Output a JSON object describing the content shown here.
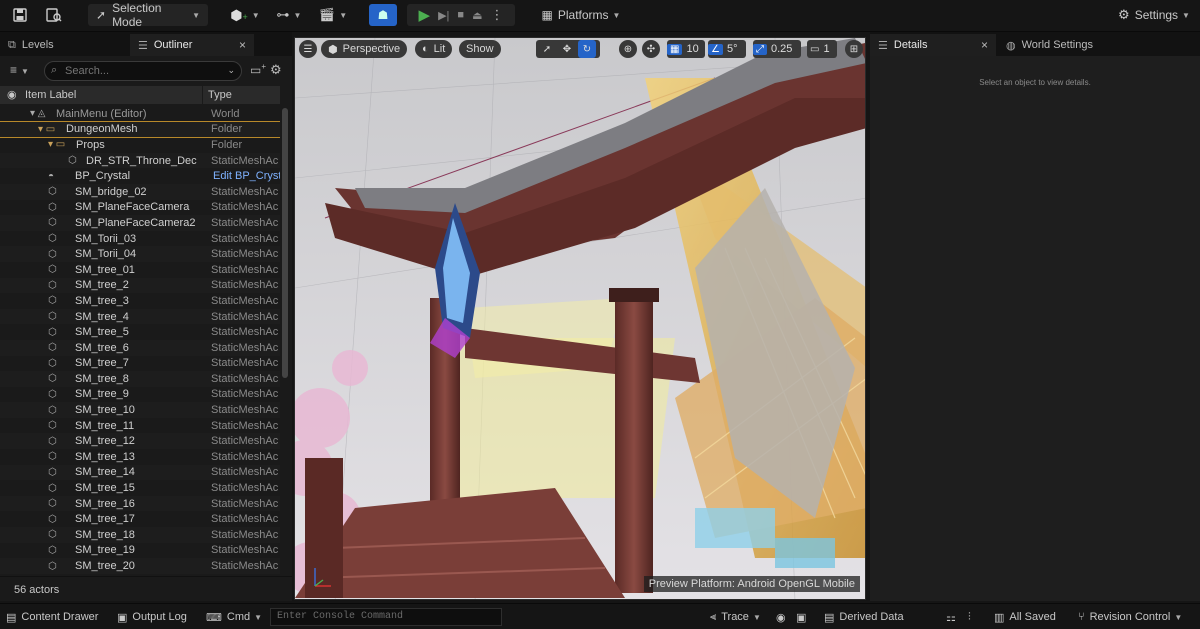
{
  "toolbar": {
    "selection_mode": "Selection Mode",
    "platforms": "Platforms",
    "settings": "Settings"
  },
  "left_panel": {
    "tabs": [
      {
        "label": "Levels"
      },
      {
        "label": "Outliner"
      }
    ],
    "close_glyph": "×",
    "search_placeholder": "Search...",
    "columns": {
      "label": "Item Label",
      "type": "Type"
    },
    "rows": [
      {
        "label": "MainMenu (Editor)",
        "type": "World",
        "indent": 0,
        "icon": "world-icon",
        "glyph": "▾ ◬"
      },
      {
        "label": "DungeonMesh",
        "type": "Folder",
        "indent": 1,
        "icon": "folder-open-icon",
        "glyph": "▾ ▭",
        "selected": true
      },
      {
        "label": "Props",
        "type": "Folder",
        "indent": 2,
        "icon": "folder-open-icon",
        "glyph": "▾ ▭"
      },
      {
        "label": "DR_STR_Throne_Dec",
        "type": "StaticMeshAc",
        "indent": 3,
        "icon": "static-mesh-icon",
        "glyph": "⬡"
      },
      {
        "label": "BP_Crystal",
        "type": "Edit BP_Cryst",
        "indent": 2,
        "icon": "blueprint-icon",
        "glyph": "◓",
        "link": true
      },
      {
        "label": "SM_bridge_02",
        "type": "StaticMeshAc",
        "indent": 2,
        "icon": "static-mesh-icon",
        "glyph": "⬡"
      },
      {
        "label": "SM_PlaneFaceCamera",
        "type": "StaticMeshAc",
        "indent": 2,
        "icon": "static-mesh-icon",
        "glyph": "⬡"
      },
      {
        "label": "SM_PlaneFaceCamera2",
        "type": "StaticMeshAc",
        "indent": 2,
        "icon": "static-mesh-icon",
        "glyph": "⬡"
      },
      {
        "label": "SM_Torii_03",
        "type": "StaticMeshAc",
        "indent": 2,
        "icon": "static-mesh-icon",
        "glyph": "⬡"
      },
      {
        "label": "SM_Torii_04",
        "type": "StaticMeshAc",
        "indent": 2,
        "icon": "static-mesh-icon",
        "glyph": "⬡"
      },
      {
        "label": "SM_tree_01",
        "type": "StaticMeshAc",
        "indent": 2,
        "icon": "static-mesh-icon",
        "glyph": "⬡"
      },
      {
        "label": "SM_tree_2",
        "type": "StaticMeshAc",
        "indent": 2,
        "icon": "static-mesh-icon",
        "glyph": "⬡"
      },
      {
        "label": "SM_tree_3",
        "type": "StaticMeshAc",
        "indent": 2,
        "icon": "static-mesh-icon",
        "glyph": "⬡"
      },
      {
        "label": "SM_tree_4",
        "type": "StaticMeshAc",
        "indent": 2,
        "icon": "static-mesh-icon",
        "glyph": "⬡"
      },
      {
        "label": "SM_tree_5",
        "type": "StaticMeshAc",
        "indent": 2,
        "icon": "static-mesh-icon",
        "glyph": "⬡"
      },
      {
        "label": "SM_tree_6",
        "type": "StaticMeshAc",
        "indent": 2,
        "icon": "static-mesh-icon",
        "glyph": "⬡"
      },
      {
        "label": "SM_tree_7",
        "type": "StaticMeshAc",
        "indent": 2,
        "icon": "static-mesh-icon",
        "glyph": "⬡"
      },
      {
        "label": "SM_tree_8",
        "type": "StaticMeshAc",
        "indent": 2,
        "icon": "static-mesh-icon",
        "glyph": "⬡"
      },
      {
        "label": "SM_tree_9",
        "type": "StaticMeshAc",
        "indent": 2,
        "icon": "static-mesh-icon",
        "glyph": "⬡"
      },
      {
        "label": "SM_tree_10",
        "type": "StaticMeshAc",
        "indent": 2,
        "icon": "static-mesh-icon",
        "glyph": "⬡"
      },
      {
        "label": "SM_tree_11",
        "type": "StaticMeshAc",
        "indent": 2,
        "icon": "static-mesh-icon",
        "glyph": "⬡"
      },
      {
        "label": "SM_tree_12",
        "type": "StaticMeshAc",
        "indent": 2,
        "icon": "static-mesh-icon",
        "glyph": "⬡"
      },
      {
        "label": "SM_tree_13",
        "type": "StaticMeshAc",
        "indent": 2,
        "icon": "static-mesh-icon",
        "glyph": "⬡"
      },
      {
        "label": "SM_tree_14",
        "type": "StaticMeshAc",
        "indent": 2,
        "icon": "static-mesh-icon",
        "glyph": "⬡"
      },
      {
        "label": "SM_tree_15",
        "type": "StaticMeshAc",
        "indent": 2,
        "icon": "static-mesh-icon",
        "glyph": "⬡"
      },
      {
        "label": "SM_tree_16",
        "type": "StaticMeshAc",
        "indent": 2,
        "icon": "static-mesh-icon",
        "glyph": "⬡"
      },
      {
        "label": "SM_tree_17",
        "type": "StaticMeshAc",
        "indent": 2,
        "icon": "static-mesh-icon",
        "glyph": "⬡"
      },
      {
        "label": "SM_tree_18",
        "type": "StaticMeshAc",
        "indent": 2,
        "icon": "static-mesh-icon",
        "glyph": "⬡"
      },
      {
        "label": "SM_tree_19",
        "type": "StaticMeshAc",
        "indent": 2,
        "icon": "static-mesh-icon",
        "glyph": "⬡"
      },
      {
        "label": "SM_tree_20",
        "type": "StaticMeshAc",
        "indent": 2,
        "icon": "static-mesh-icon",
        "glyph": "⬡"
      }
    ],
    "actor_count": "56 actors"
  },
  "viewport": {
    "perspective": "Perspective",
    "lit": "Lit",
    "show": "Show",
    "grid_snap": "10",
    "rotation_snap": "5°",
    "scale_snap": "0.25",
    "camera_speed": "1",
    "preview_platform": "Preview Platform:  Android OpenGL Mobile"
  },
  "right_panel": {
    "tabs": [
      {
        "label": "Details"
      },
      {
        "label": "World Settings"
      }
    ],
    "close_glyph": "×",
    "empty_message": "Select an object to view details."
  },
  "status_bar": {
    "content_drawer": "Content Drawer",
    "output_log": "Output Log",
    "cmd": "Cmd",
    "cmd_placeholder": "Enter Console Command",
    "trace": "Trace",
    "derived_data": "Derived Data",
    "all_saved": "All Saved",
    "revision_control": "Revision Control"
  },
  "colors": {
    "accent_blue": "#2564c8",
    "play_green": "#4caf50",
    "selection_outline": "#b8892a",
    "link_blue": "#7fb2ff"
  }
}
